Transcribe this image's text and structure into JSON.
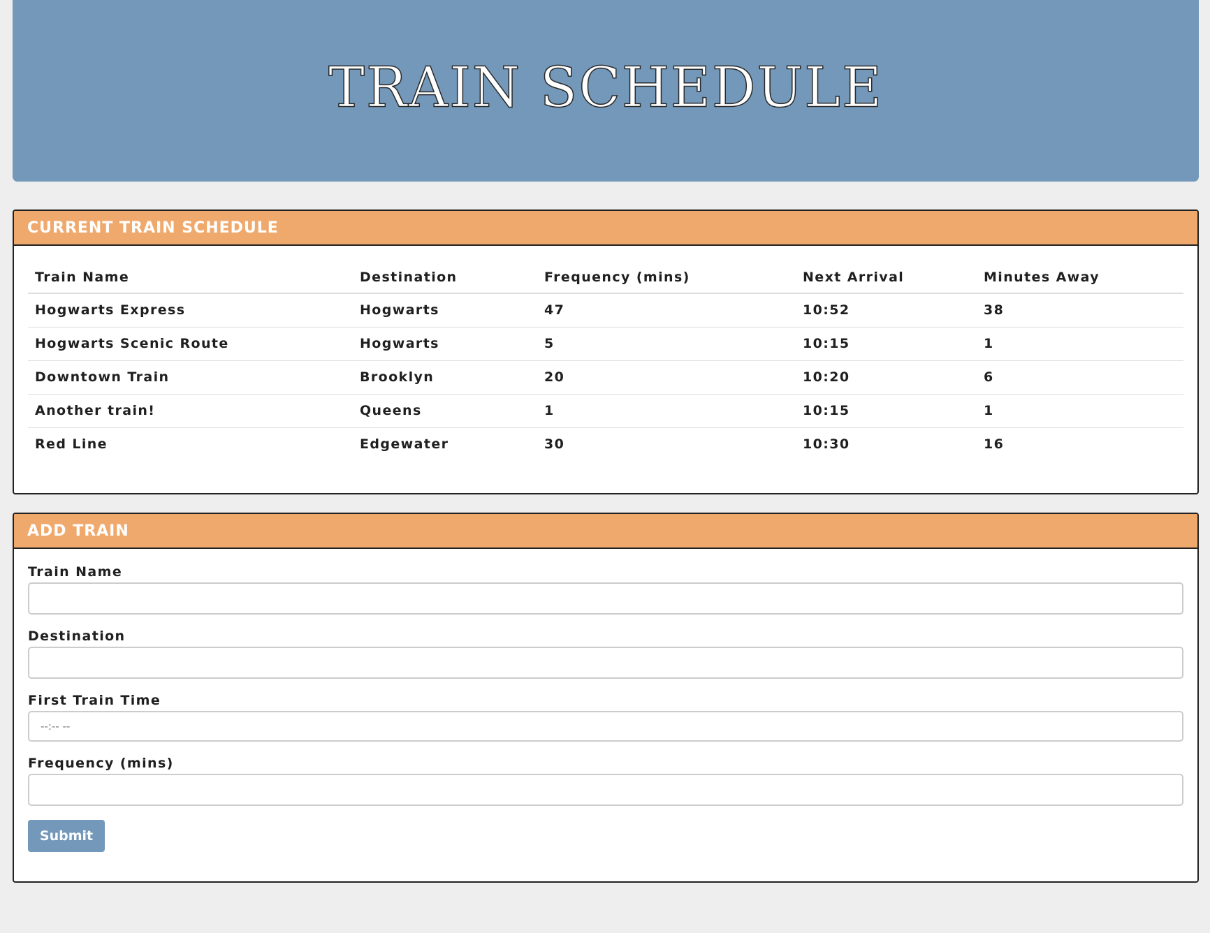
{
  "header": {
    "title": "TRAIN SCHEDULE"
  },
  "schedule": {
    "heading": "CURRENT TRAIN SCHEDULE",
    "columns": [
      "Train Name",
      "Destination",
      "Frequency (mins)",
      "Next Arrival",
      "Minutes Away"
    ],
    "rows": [
      [
        "Hogwarts Express",
        "Hogwarts",
        "47",
        "10:52",
        "38"
      ],
      [
        "Hogwarts Scenic Route",
        "Hogwarts",
        "5",
        "10:15",
        "1"
      ],
      [
        "Downtown Train",
        "Brooklyn",
        "20",
        "10:20",
        "6"
      ],
      [
        "Another train!",
        "Queens",
        "1",
        "10:15",
        "1"
      ],
      [
        "Red Line",
        "Edgewater",
        "30",
        "10:30",
        "16"
      ]
    ]
  },
  "add_train": {
    "heading": "ADD TRAIN",
    "fields": {
      "train_name": {
        "label": "Train Name",
        "value": ""
      },
      "destination": {
        "label": "Destination",
        "value": ""
      },
      "first_train_time": {
        "label": "First Train Time",
        "value": "",
        "placeholder": "--:-- --"
      },
      "frequency": {
        "label": "Frequency (mins)",
        "value": ""
      }
    },
    "submit_label": "Submit"
  },
  "colors": {
    "header_bg": "#7398b9",
    "panel_heading_bg": "#f0a96c",
    "page_bg": "#eeeeee",
    "button_bg": "#7398b9"
  }
}
